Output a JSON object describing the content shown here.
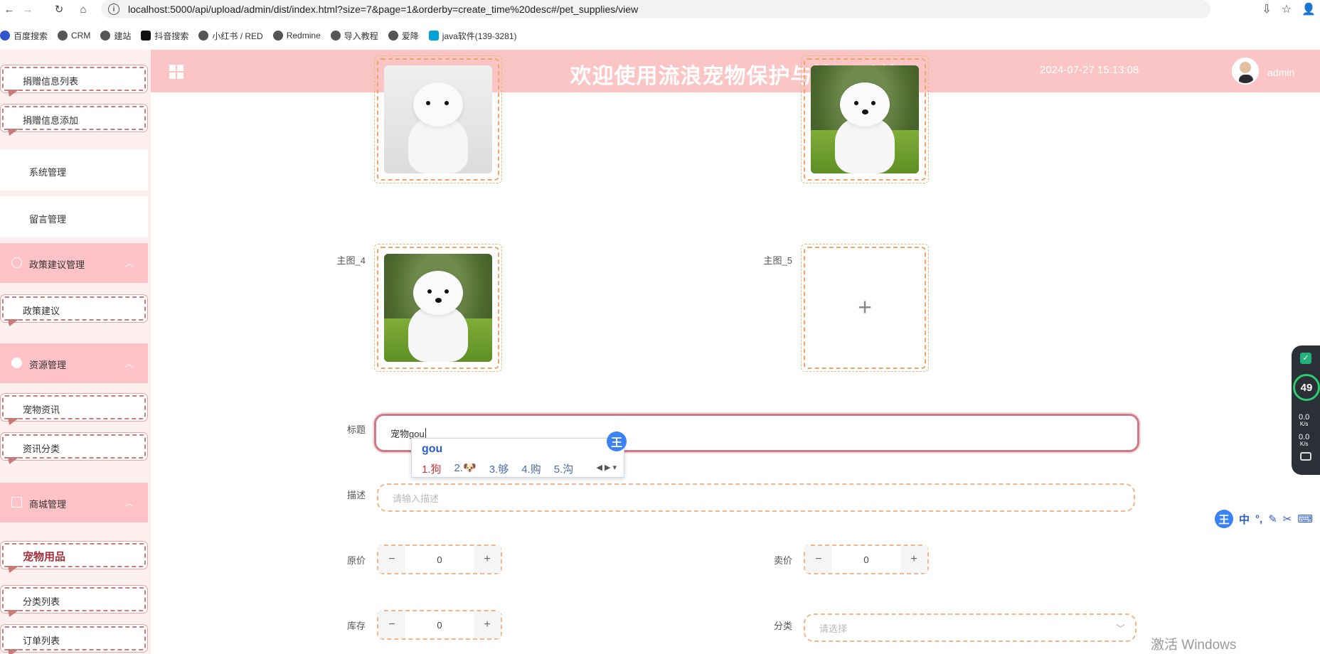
{
  "browser": {
    "url": "localhost:5000/api/upload/admin/dist/index.html?size=7&page=1&orderby=create_time%20desc#/pet_supplies/view",
    "bookmarks": [
      "百度搜索",
      "CRM",
      "建站",
      "抖音搜索",
      "小红书 / RED",
      "Redmine",
      "导入教程",
      "爱降",
      "java软件(139-3281)"
    ]
  },
  "header": {
    "title": "欢迎使用流浪宠物保护与管理系统",
    "datetime": "2024-07-27 15:13:08",
    "user": "admin"
  },
  "sidebar": {
    "donation_list": "捐赠信息列表",
    "donation_add": "捐赠信息添加",
    "system_mgmt": "系统管理",
    "message_mgmt": "留言管理",
    "policy_group": "政策建议管理",
    "policy_item": "政策建议",
    "resource_group": "资源管理",
    "pet_news": "宠物资讯",
    "news_category": "资讯分类",
    "mall_group": "商城管理",
    "pet_supplies": "宠物用品",
    "category_list": "分类列表",
    "order_list": "订单列表"
  },
  "form": {
    "main_image_4_label": "主图_4",
    "main_image_5_label": "主图_5",
    "title_label": "标题",
    "title_value": "宠物gou",
    "desc_label": "描述",
    "desc_placeholder": "请输入描述",
    "orig_price_label": "原价",
    "orig_price_value": "0",
    "sale_price_label": "卖价",
    "sale_price_value": "0",
    "stock_label": "库存",
    "stock_value": "0",
    "category_label": "分类",
    "category_placeholder": "请选择"
  },
  "ime": {
    "composition": "gou",
    "candidates": [
      "1.狗",
      "2.🐶",
      "3.够",
      "4.购",
      "5.沟"
    ],
    "badge": "王"
  },
  "net_widget": {
    "percent": "49",
    "up_rate": "0.0",
    "down_rate": "0.0",
    "unit": "K/s"
  },
  "ime_bar": {
    "badge": "王",
    "mode": "中"
  },
  "watermark": "激活 Windows"
}
